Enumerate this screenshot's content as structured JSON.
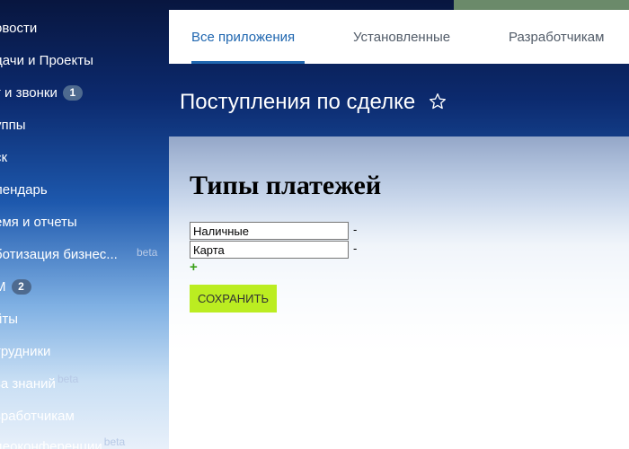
{
  "sidebar": {
    "items": [
      {
        "label": "овости"
      },
      {
        "label": "дачи и Проекты"
      },
      {
        "label": "т и звонки",
        "counter": "1"
      },
      {
        "label": "уппы"
      },
      {
        "label": "ск"
      },
      {
        "label": "лендарь"
      },
      {
        "label": "емя и отчеты"
      },
      {
        "label": "ботизация бизнес...",
        "badge": "beta"
      },
      {
        "label": "М",
        "counter": "2"
      },
      {
        "label": "йты"
      },
      {
        "label": "трудники"
      },
      {
        "label": "за знаний",
        "badge": "beta"
      },
      {
        "label": "зработчикам"
      },
      {
        "label": "деоконференции",
        "badge": "beta"
      }
    ]
  },
  "tabs": [
    {
      "label": "Все приложения",
      "active": true
    },
    {
      "label": "Установленные",
      "active": false
    },
    {
      "label": "Разработчикам",
      "active": false
    }
  ],
  "page": {
    "title": "Поступления по сделке"
  },
  "content": {
    "heading": "Типы платежей",
    "payment_types": [
      {
        "value": "Наличные",
        "remove_label": "-"
      },
      {
        "value": "Карта",
        "remove_label": "-"
      }
    ],
    "add_label": "+",
    "save_label": "СОХРАНИТЬ"
  },
  "colors": {
    "accent": "#2067b0",
    "save_button": "#bbed21",
    "add_link": "#3aa018"
  }
}
